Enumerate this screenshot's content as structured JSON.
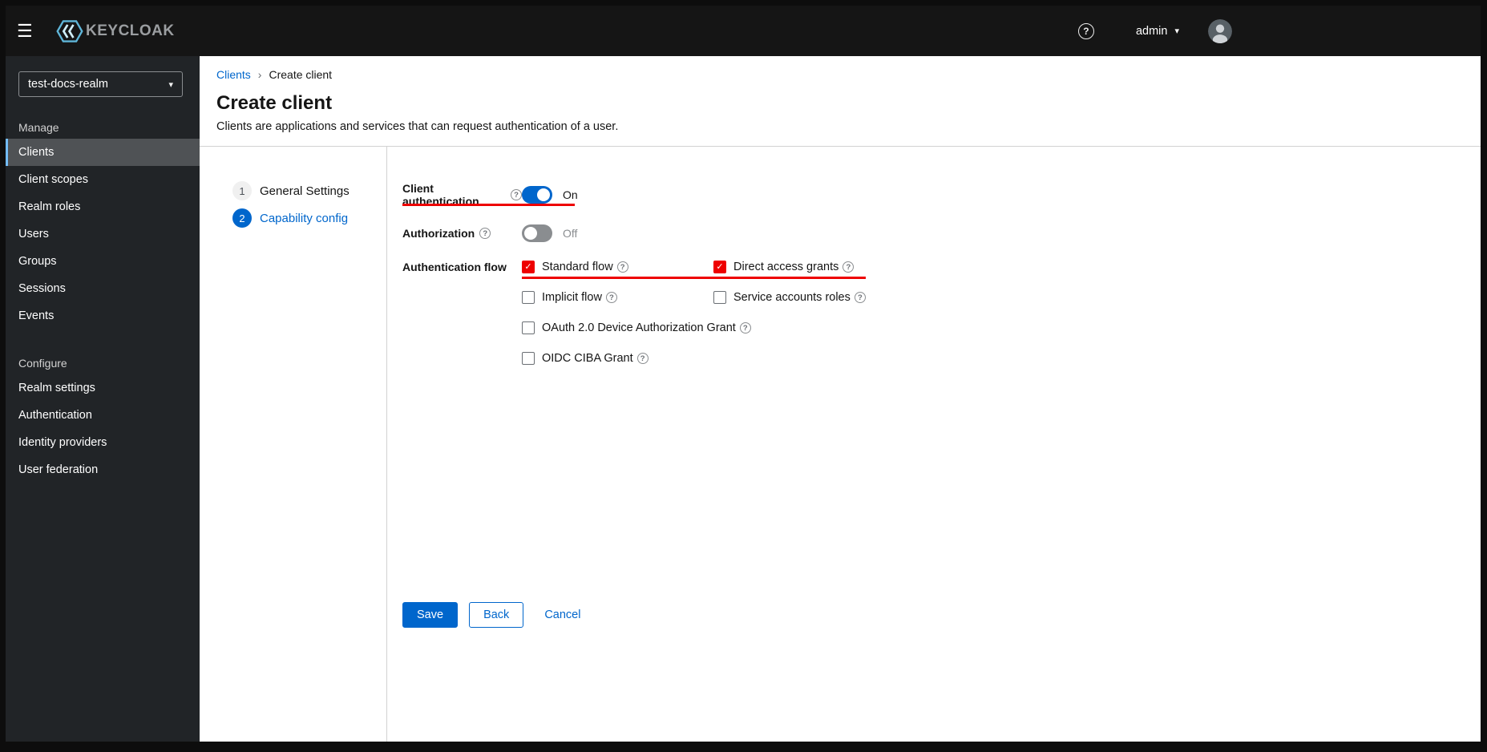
{
  "colors": {
    "accent": "#0066cc",
    "annotation_red": "#ee0000",
    "masthead_bg": "#151515",
    "sidebar_bg": "#212427",
    "selected_nav_bg": "#4f5255"
  },
  "icons": {
    "help": "?",
    "caret_down": "▾",
    "breadcrumb_separator": "›",
    "check": "✓",
    "hamburger": "☰"
  },
  "header": {
    "logo": "KEYCLOAK",
    "user_label": "admin"
  },
  "sidebar": {
    "realm": "test-docs-realm",
    "manage": {
      "label": "Manage",
      "items": [
        "Clients",
        "Client scopes",
        "Realm roles",
        "Users",
        "Groups",
        "Sessions",
        "Events"
      ]
    },
    "configure": {
      "label": "Configure",
      "items": [
        "Realm settings",
        "Authentication",
        "Identity providers",
        "User federation"
      ]
    }
  },
  "breadcrumb": {
    "parent": "Clients",
    "current": "Create client"
  },
  "page": {
    "title": "Create client",
    "description": "Clients are applications and services that can request authentication of a user."
  },
  "wizard": {
    "steps": [
      {
        "number": "1",
        "label": "General Settings",
        "active": false
      },
      {
        "number": "2",
        "label": "Capability config",
        "active": true
      }
    ]
  },
  "form": {
    "client_authentication": {
      "label": "Client authentication",
      "state": "On",
      "on": true
    },
    "authorization": {
      "label": "Authorization",
      "state": "Off",
      "on": false
    },
    "authentication_flow": {
      "label": "Authentication flow",
      "options": [
        {
          "label": "Standard flow",
          "checked": true
        },
        {
          "label": "Direct access grants",
          "checked": true
        },
        {
          "label": "Implicit flow",
          "checked": false
        },
        {
          "label": "Service accounts roles",
          "checked": false
        },
        {
          "label": "OAuth 2.0 Device Authorization Grant",
          "checked": false
        },
        {
          "label": "OIDC CIBA Grant",
          "checked": false
        }
      ]
    }
  },
  "footer": {
    "save": "Save",
    "back": "Back",
    "cancel": "Cancel"
  }
}
